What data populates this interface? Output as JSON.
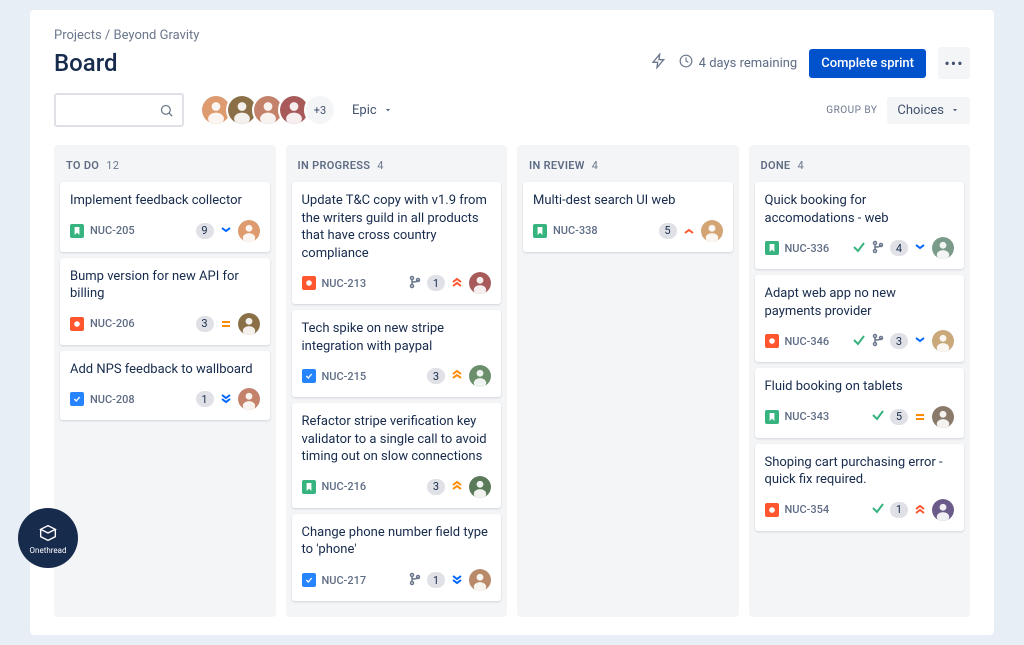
{
  "breadcrumb": {
    "parent": "Projects",
    "project": "Beyond Gravity"
  },
  "title": "Board",
  "header": {
    "time_remaining": "4 days remaining",
    "complete_sprint": "Complete sprint"
  },
  "toolbar": {
    "avatar_more": "+3",
    "epic_label": "Epic",
    "group_by_label": "GROUP BY",
    "choices_label": "Choices"
  },
  "columns": [
    {
      "name": "TO DO",
      "count": "12"
    },
    {
      "name": "IN PROGRESS",
      "count": "4"
    },
    {
      "name": "IN REVIEW",
      "count": "4"
    },
    {
      "name": "DONE",
      "count": "4"
    }
  ],
  "cards": {
    "todo": [
      {
        "title": "Implement feedback collector",
        "key": "NUC-205",
        "type": "story",
        "points": "9",
        "priority": "low",
        "avatar": 0
      },
      {
        "title": "Bump version for new API for billing",
        "key": "NUC-206",
        "type": "bug",
        "points": "3",
        "priority": "medium",
        "avatar": 1
      },
      {
        "title": "Add NPS feedback to wallboard",
        "key": "NUC-208",
        "type": "task",
        "points": "1",
        "priority": "lowest",
        "avatar": 2
      }
    ],
    "progress": [
      {
        "title": "Update T&C copy with v1.9 from the writers guild in all products that have cross country compliance",
        "key": "NUC-213",
        "type": "bug",
        "branch": true,
        "points": "1",
        "priority": "highest",
        "avatar": 3
      },
      {
        "title": "Tech spike on new stripe integration with paypal",
        "key": "NUC-215",
        "type": "task",
        "points": "3",
        "priority": "high",
        "avatar": 4
      },
      {
        "title": "Refactor stripe verification key validator to a single call to avoid timing out on slow connections",
        "key": "NUC-216",
        "type": "story",
        "points": "3",
        "priority": "high",
        "avatar": 5
      },
      {
        "title": "Change phone number field type to 'phone'",
        "key": "NUC-217",
        "type": "task",
        "branch": true,
        "points": "1",
        "priority": "lowest",
        "avatar": 6
      }
    ],
    "review": [
      {
        "title": "Multi-dest search UI web",
        "key": "NUC-338",
        "type": "story",
        "points": "5",
        "priority": "high-red",
        "avatar": 7
      }
    ],
    "done": [
      {
        "title": "Quick booking for accomodations - web",
        "key": "NUC-336",
        "type": "story",
        "done": true,
        "branch": true,
        "points": "4",
        "priority": "low",
        "avatar": 8
      },
      {
        "title": "Adapt web app no new payments provider",
        "key": "NUC-346",
        "type": "bug",
        "done": true,
        "branch": true,
        "points": "3",
        "priority": "low",
        "avatar": 9
      },
      {
        "title": "Fluid booking on tablets",
        "key": "NUC-343",
        "type": "story",
        "done": true,
        "points": "5",
        "priority": "medium",
        "avatar": 10
      },
      {
        "title": "Shoping cart purchasing error - quick fix required.",
        "key": "NUC-354",
        "type": "bug",
        "done": true,
        "points": "1",
        "priority": "highest",
        "avatar": 11
      }
    ]
  },
  "avatar_colors": [
    "#de9b6f",
    "#8b6f47",
    "#c4826a",
    "#a85a5a",
    "#6b8e6b",
    "#5a7a5a",
    "#b88a6a",
    "#d4a574",
    "#7a9a8a",
    "#c9a87a",
    "#8a7a6a",
    "#6a5a8a"
  ],
  "watermark": "Onethread"
}
